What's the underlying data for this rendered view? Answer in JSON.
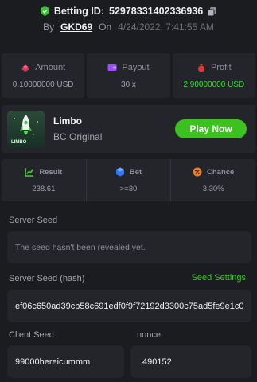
{
  "header": {
    "bet_label": "Betting ID:",
    "bet_id": "52978331402336936",
    "by": "By",
    "user": "GKD69",
    "on": "On",
    "date": "4/24/2022, 7:41:55 AM"
  },
  "stats": {
    "amount": {
      "label": "Amount",
      "value": "0.10000000 USD",
      "icon": "coins-icon"
    },
    "payout": {
      "label": "Payout",
      "value": "30 x",
      "icon": "wallet-icon"
    },
    "profit": {
      "label": "Profit",
      "value": "2.90000000 USD",
      "icon": "money-bag-icon"
    }
  },
  "game": {
    "thumb_word": "LIMBO",
    "name": "Limbo",
    "subtitle": "BC Original",
    "play_label": "Play Now"
  },
  "result": {
    "result": {
      "label": "Result",
      "value": "238.61"
    },
    "bet": {
      "label": "Bet",
      "value": ">=30"
    },
    "chance": {
      "label": "Chance",
      "value": "3.30%"
    }
  },
  "seeds": {
    "server_seed_label": "Server Seed",
    "server_seed_value": "The seed hasn't been revealed yet.",
    "server_hash_label": "Server Seed (hash)",
    "seed_settings": "Seed Settings",
    "server_hash_value": "ef06c650ad39cb58c691edf0f9f72192d3300c75ad5fe9e1c0",
    "client_seed_label": "Client Seed",
    "client_seed_value": "99000hereicummm",
    "nonce_label": "nonce",
    "nonce_value": "490152"
  },
  "colors": {
    "accent_green": "#3cc121",
    "background": "#1b1c20",
    "panel": "#24252b"
  }
}
